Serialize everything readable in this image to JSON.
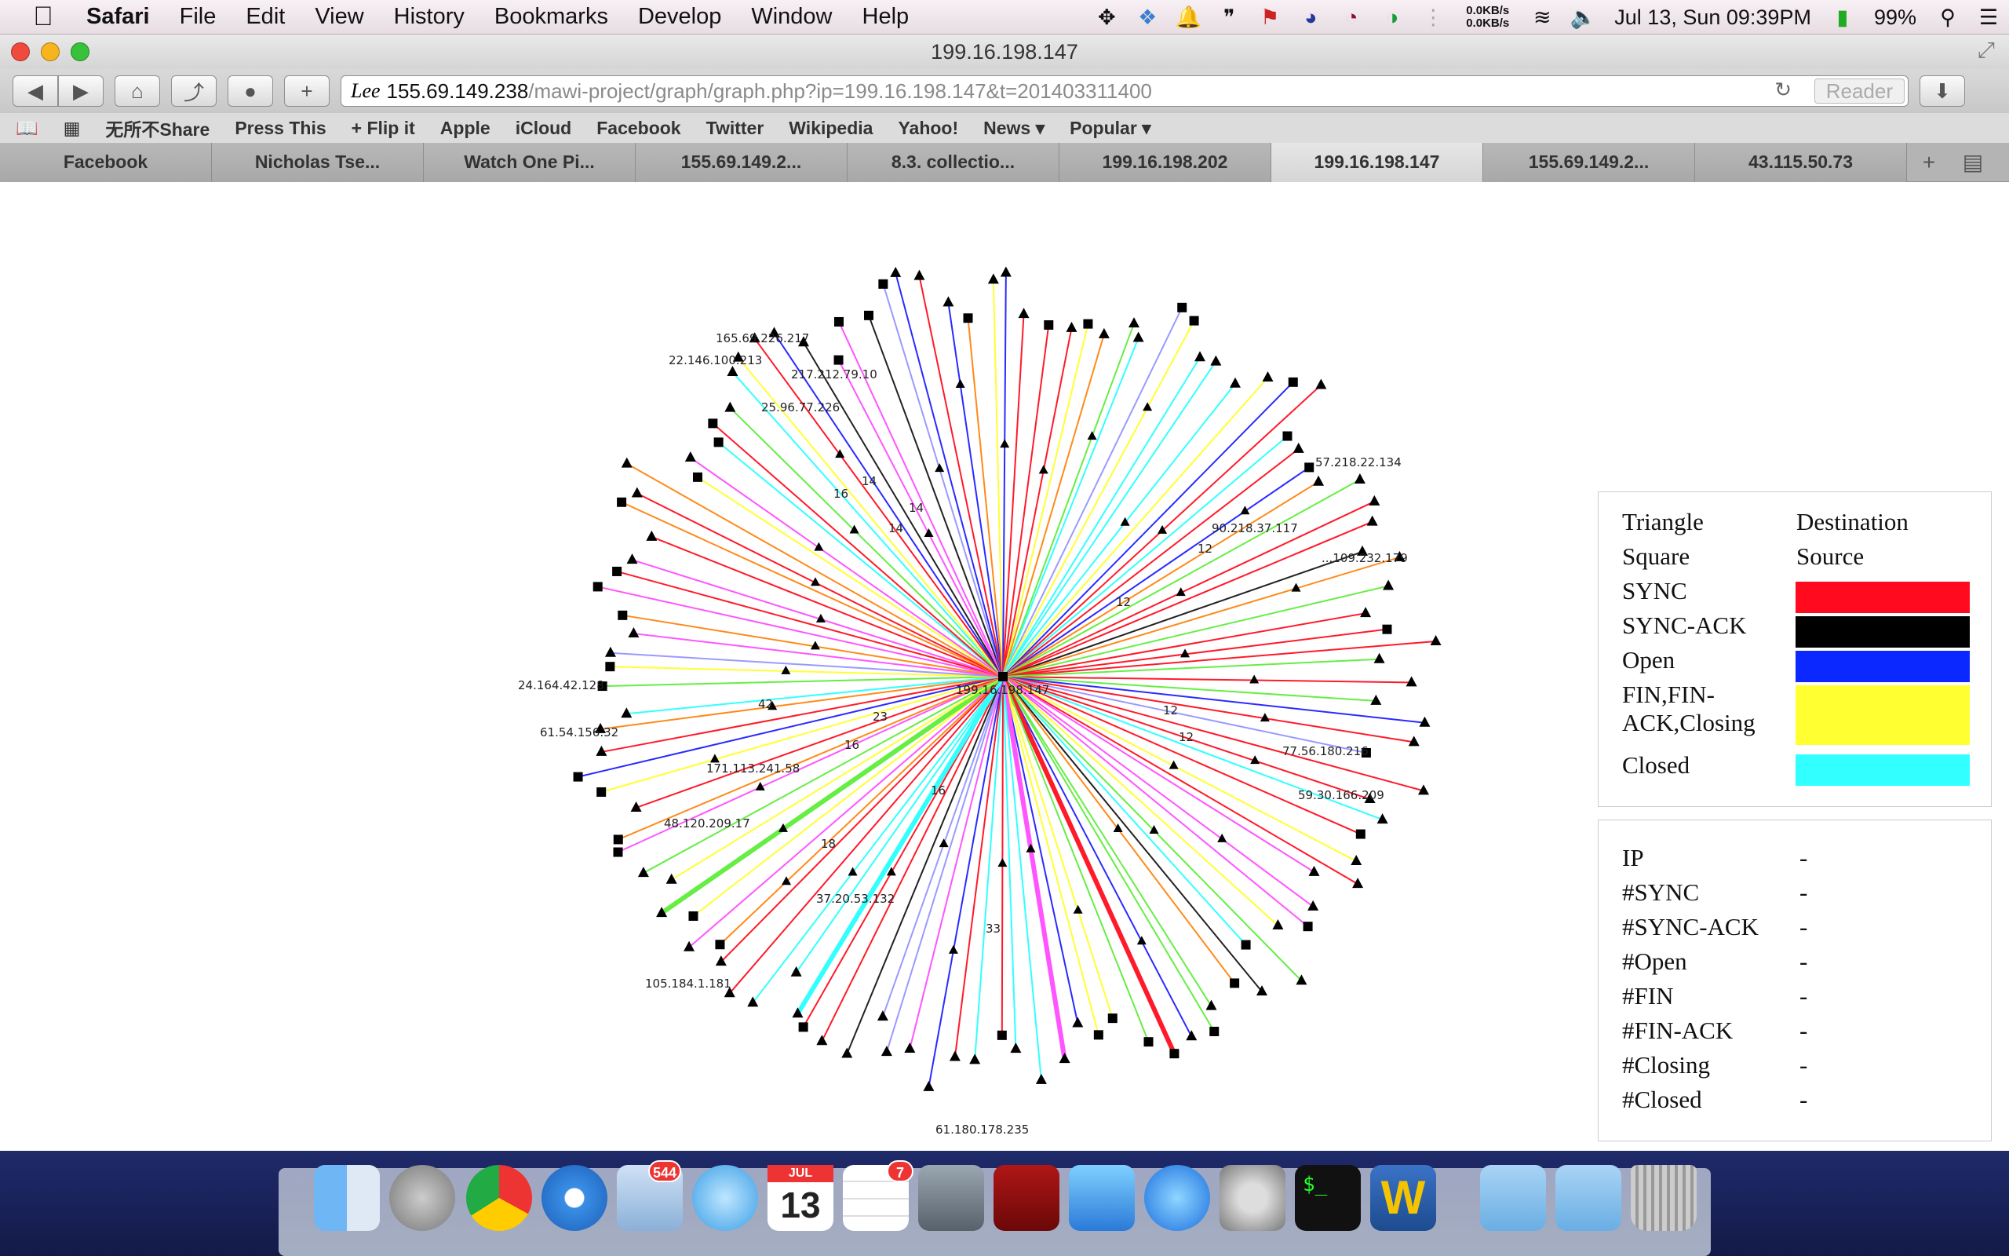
{
  "menubar": {
    "app": "Safari",
    "items": [
      "File",
      "Edit",
      "View",
      "History",
      "Bookmarks",
      "Develop",
      "Window",
      "Help"
    ],
    "net_up": "0.0KB/s",
    "net_down": "0.0KB/s",
    "clock": "Jul 13, Sun 09:39PM",
    "battery": "99%"
  },
  "window": {
    "title": "199.16.198.147"
  },
  "url": {
    "host": "155.69.149.238",
    "path": "/mawi-project/graph/graph.php?ip=199.16.198.147&t=201403311400",
    "reader": "Reader"
  },
  "bookmarks": [
    "无所不Share",
    "Press This",
    "+ Flip it",
    "Apple",
    "iCloud",
    "Facebook",
    "Twitter",
    "Wikipedia",
    "Yahoo!",
    "News ▾",
    "Popular ▾"
  ],
  "tabs": [
    "Facebook",
    "Nicholas Tse...",
    "Watch One Pi...",
    "155.69.149.2...",
    "8.3. collectio...",
    "199.16.198.202",
    "199.16.198.147",
    "155.69.149.2...",
    "43.115.50.73"
  ],
  "active_tab": 6,
  "legend": {
    "triangle": "Triangle",
    "triangle_val": "Destination",
    "square": "Square",
    "square_val": "Source",
    "sync": "SYNC",
    "syncack": "SYNC-ACK",
    "open": "Open",
    "fin1": "FIN,FIN-",
    "fin2": "ACK,Closing",
    "closed": "Closed",
    "colors": {
      "sync": "#ff0a1e",
      "syncack": "#000000",
      "open": "#0a28ff",
      "fin": "#ffff32",
      "closed": "#32ffff"
    }
  },
  "stats": [
    {
      "label": "IP",
      "value": "-"
    },
    {
      "label": "#SYNC",
      "value": "-"
    },
    {
      "label": "#SYNC-ACK",
      "value": "-"
    },
    {
      "label": "#Open",
      "value": "-"
    },
    {
      "label": "#FIN",
      "value": "-"
    },
    {
      "label": "#FIN-ACK",
      "value": "-"
    },
    {
      "label": "#Closing",
      "value": "-"
    },
    {
      "label": "#Closed",
      "value": "-"
    }
  ],
  "graph": {
    "center_ip": "199.16.198.147",
    "edge_count": 120,
    "node_labels": [
      "165.69.226.217",
      "22.146.100.213",
      "217.212.79.10",
      "25.96.77.226",
      "57.218.22.134",
      "90.218.37.117",
      "...109.232.179",
      "24.164.42.128",
      "61.54.156.32",
      "171.113.241.58",
      "48.120.209.17",
      "37.20.53.132",
      "105.184.1.181",
      "61.180.178.235",
      "77.56.180.216",
      "59.30.166.209"
    ],
    "edge_labels": [
      "16",
      "14",
      "14",
      "14",
      "12",
      "12",
      "12",
      "12",
      "42",
      "23",
      "16",
      "18",
      "16",
      "33"
    ]
  },
  "dock": {
    "mail_badge": "544",
    "reminders_badge": "7",
    "calendar_month": "JUL",
    "calendar_day": "13"
  }
}
